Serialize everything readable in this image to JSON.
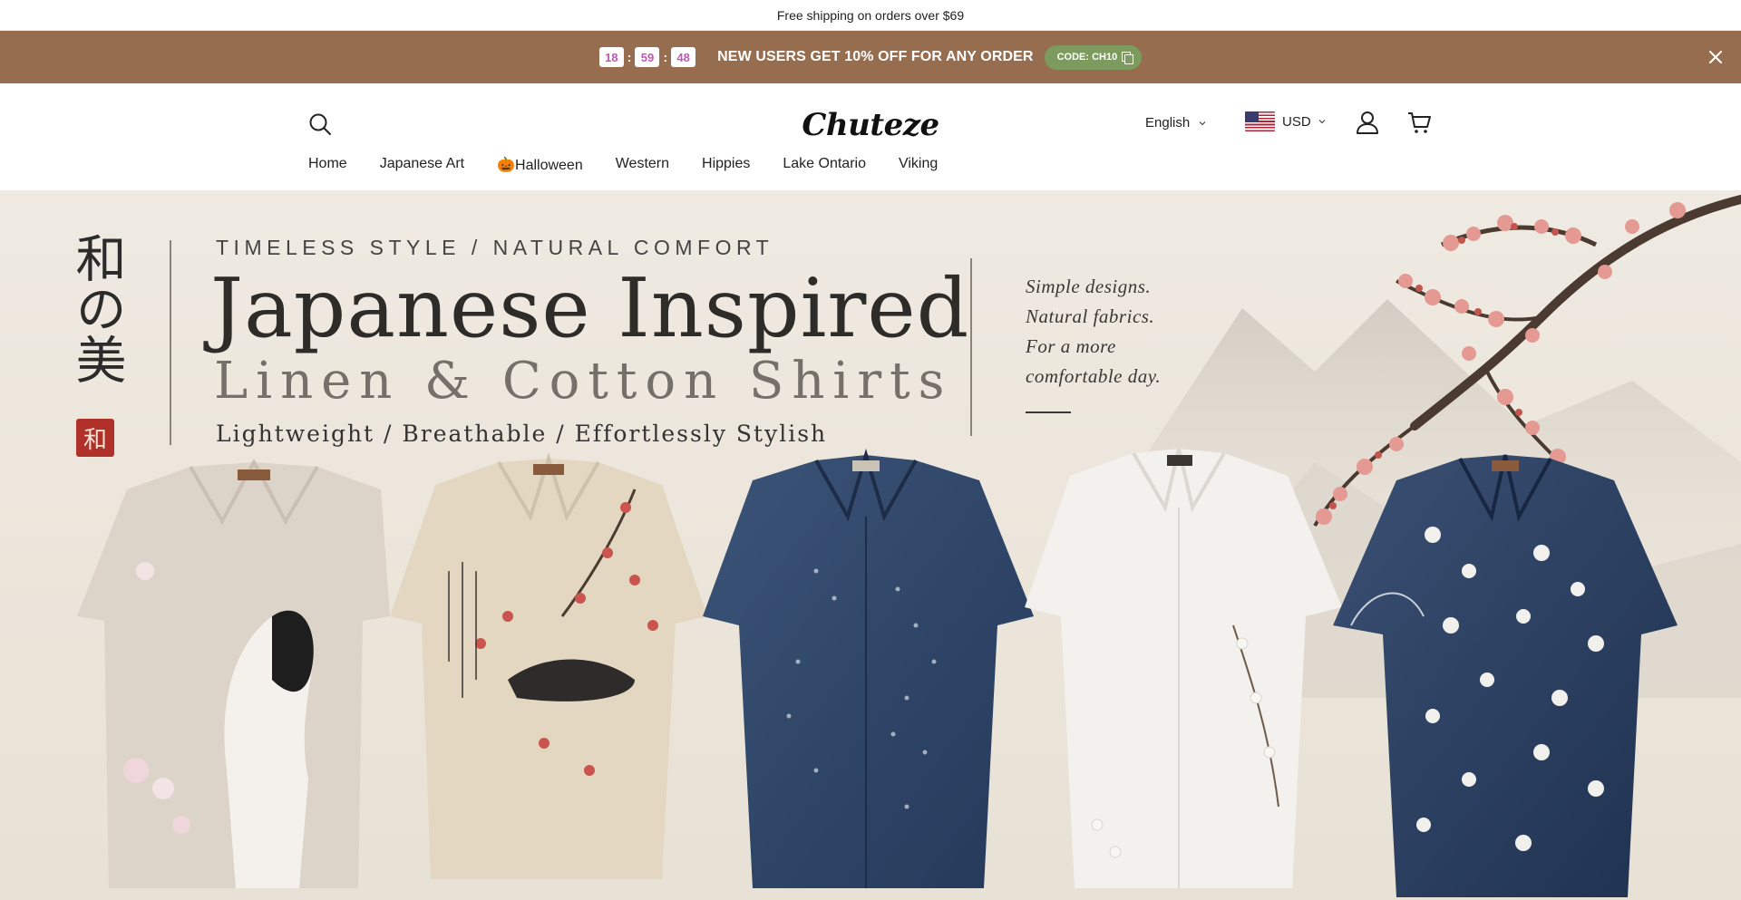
{
  "announcement": {
    "text": "Free shipping on orders over $69"
  },
  "promo": {
    "timer": {
      "hours": "18",
      "minutes": "59",
      "seconds": "48",
      "separator": ":"
    },
    "message": "NEW USERS GET 10% OFF FOR ANY ORDER",
    "code_label": "CODE: CH10",
    "background": "#976d4f",
    "code_color": "#7e9b5f"
  },
  "header": {
    "logo": "Chuteze",
    "language": "English",
    "currency": "USD",
    "icons": {
      "search": "search-icon",
      "account": "user-icon",
      "cart": "cart-icon"
    }
  },
  "nav": {
    "items": [
      {
        "label": "Home"
      },
      {
        "label": "Japanese Art"
      },
      {
        "label": "🎃Halloween"
      },
      {
        "label": "Western"
      },
      {
        "label": "Hippies"
      },
      {
        "label": "Lake Ontario"
      },
      {
        "label": "Viking"
      }
    ]
  },
  "hero": {
    "kanji": "和の美",
    "seal": "和",
    "tagline": "TIMELESS STYLE  /  NATURAL COMFORT",
    "title": "Japanese Inspired",
    "subtitle": "Linen & Cotton Shirts",
    "features": "Lightweight  /  Breathable  /  Effortlessly Stylish",
    "quote_lines": [
      "Simple designs.",
      "Natural fabrics.",
      "For a more",
      "comfortable day."
    ]
  }
}
